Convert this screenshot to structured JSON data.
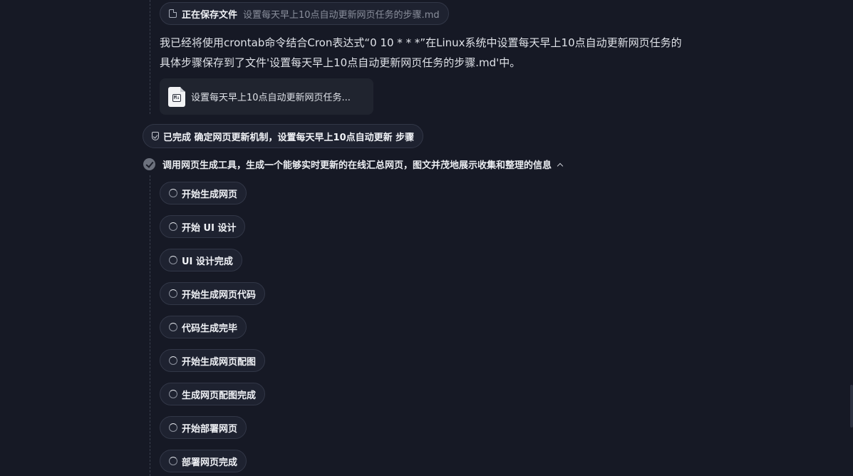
{
  "saving_pill": {
    "label": "正在保存文件",
    "filename": "设置每天早上10点自动更新网页任务的步骤.md"
  },
  "message": {
    "text": "我已经将使用crontab命令结合Cron表达式“0 10 * * *”在Linux系统中设置每天早上10点自动更新网页任务的具体步骤保存到了文件'设置每天早上10点自动更新网页任务的步骤.md'中。"
  },
  "file_card": {
    "icon_text": "M↓",
    "name": "设置每天早上10点自动更新网页任务..."
  },
  "completed_pill": {
    "label": "已完成 确定网页更新机制，设置每天早上10点自动更新 步骤"
  },
  "step": {
    "title": "调用网页生成工具，生成一个能够实时更新的在线汇总网页，图文并茂地展示收集和整理的信息",
    "substeps": [
      "开始生成网页",
      "开始 UI 设计",
      "UI 设计完成",
      "开始生成网页代码",
      "代码生成完毕",
      "开始生成网页配图",
      "生成网页配图完成",
      "开始部署网页",
      "部署网页完成"
    ]
  }
}
